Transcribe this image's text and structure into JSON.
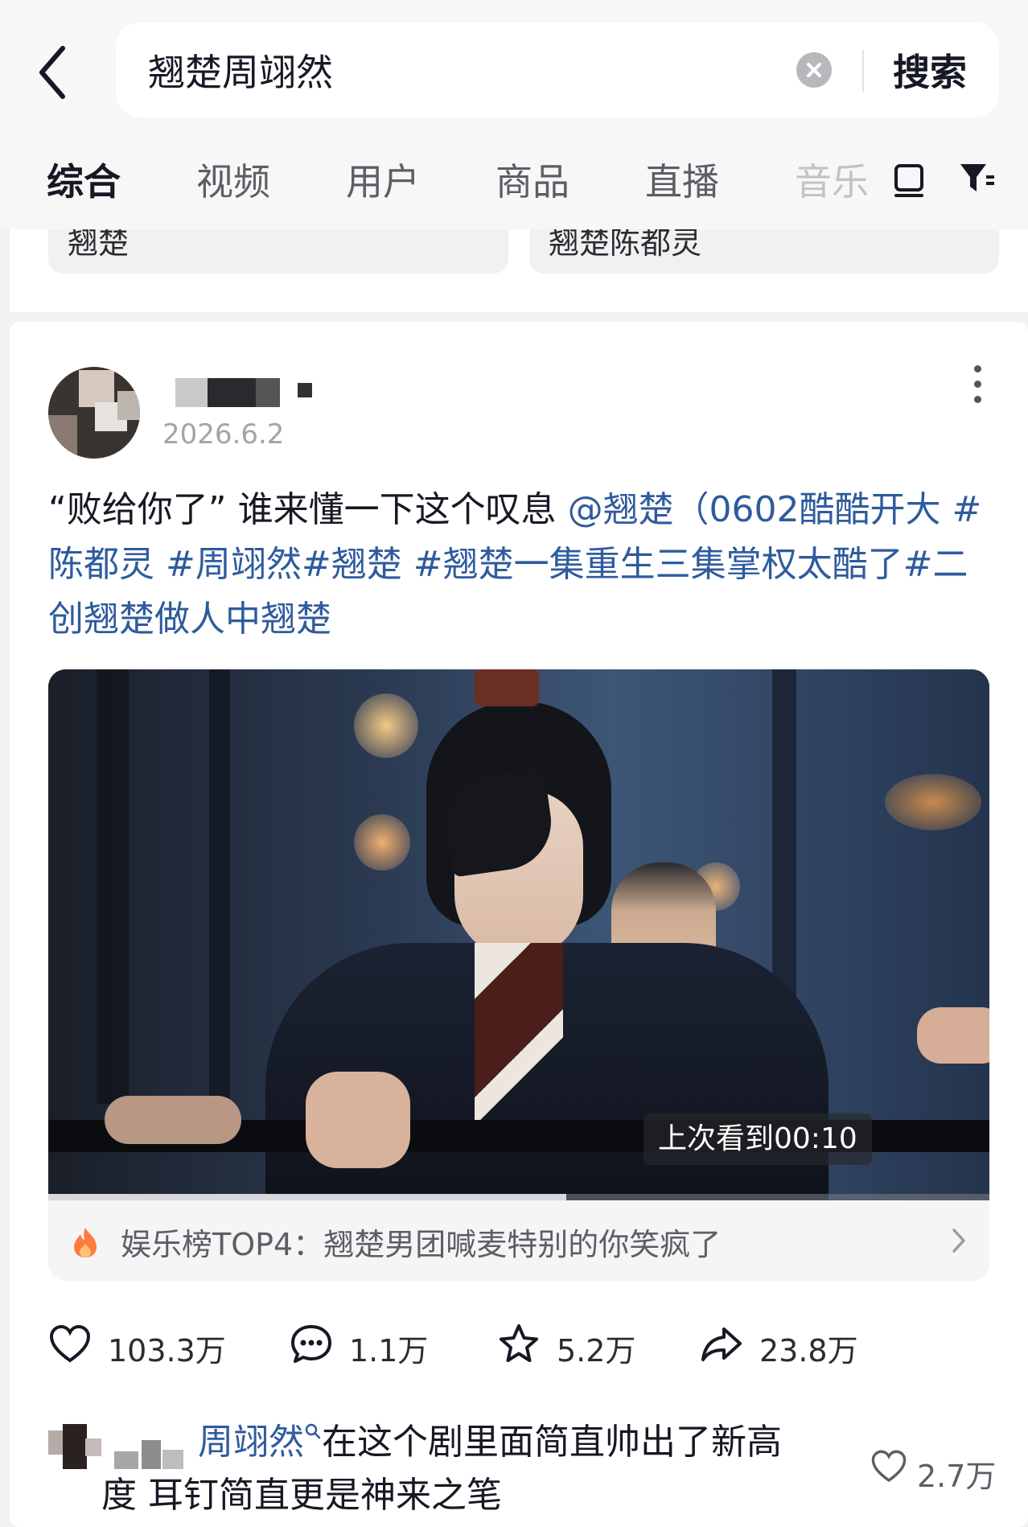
{
  "search": {
    "query": "翘楚周翊然",
    "button_label": "搜索"
  },
  "tabs": [
    {
      "label": "综合"
    },
    {
      "label": "视频"
    },
    {
      "label": "用户"
    },
    {
      "label": "商品"
    },
    {
      "label": "直播"
    },
    {
      "label": "音乐"
    }
  ],
  "cards": {
    "left_label": "翘楚",
    "right_label": "翘楚陈都灵"
  },
  "post": {
    "date": "2026.6.2",
    "caption_text": "“败给你了” 谁来懂一下这个叹息 ",
    "caption_mention": "@翘楚（0602酷酷开大 #陈都灵 #周翊然#翘楚 #翘楚一集重生三集掌权太酷了#二创翘楚做人中翘楚",
    "video": {
      "resume_label": "上次看到00:10",
      "progress_fraction": 0.55
    },
    "rank": {
      "text": "娱乐榜TOP4：翘楚男团喊麦特别的你笑疯了"
    },
    "stats": {
      "likes": "103.3万",
      "comments": "1.1万",
      "favorites": "5.2万",
      "shares": "23.8万"
    }
  },
  "comment": {
    "mention": "周翊然",
    "text_line1": "在这个剧里面简直帅出了新高",
    "text_line2": "度 耳钉简直更是神来之笔",
    "likes": "2.7万"
  }
}
